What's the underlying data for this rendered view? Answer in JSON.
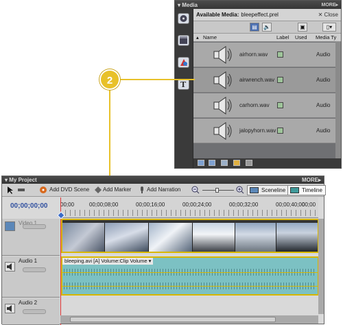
{
  "media_panel": {
    "title": "Media",
    "more": "MORE▸",
    "header_label": "Available Media:",
    "project_file": "bleepeffect.prel",
    "close": "✕ Close",
    "columns": {
      "name": "Name",
      "label": "Label",
      "used": "Used",
      "type": "Media Ty"
    },
    "items": [
      {
        "name": "airhorn.wav",
        "type": "Audio"
      },
      {
        "name": "airwrench.wav",
        "type": "Audio",
        "selected": true
      },
      {
        "name": "carhorn.wav",
        "type": "Audio"
      },
      {
        "name": "jalopyhorn.wav",
        "type": "Audio"
      }
    ],
    "label_color": "#9ec49a"
  },
  "callout": {
    "number": "2",
    "color": "#e8c12a"
  },
  "project_panel": {
    "title": "My Project",
    "more": "MORE▸",
    "toolbar": {
      "add_dvd_scene": "Add DVD Scene",
      "add_marker": "Add Marker",
      "add_narration": "Add Narration",
      "sceneline": "Sceneline",
      "timeline": "Timeline"
    },
    "timecode": "00;00;00;00",
    "ruler": [
      "00;00",
      "00;00;08;00",
      "00;00;16;00",
      "00;00;24;00",
      "00;00;32;00",
      "00;00;40;00",
      "00;00"
    ],
    "tracks": {
      "video1": "Video 1",
      "audio1": "Audio 1",
      "audio2": "Audio 2"
    },
    "audio_clip_label": "bleeping.avi [A] Volume:Clip Volume ▾"
  }
}
